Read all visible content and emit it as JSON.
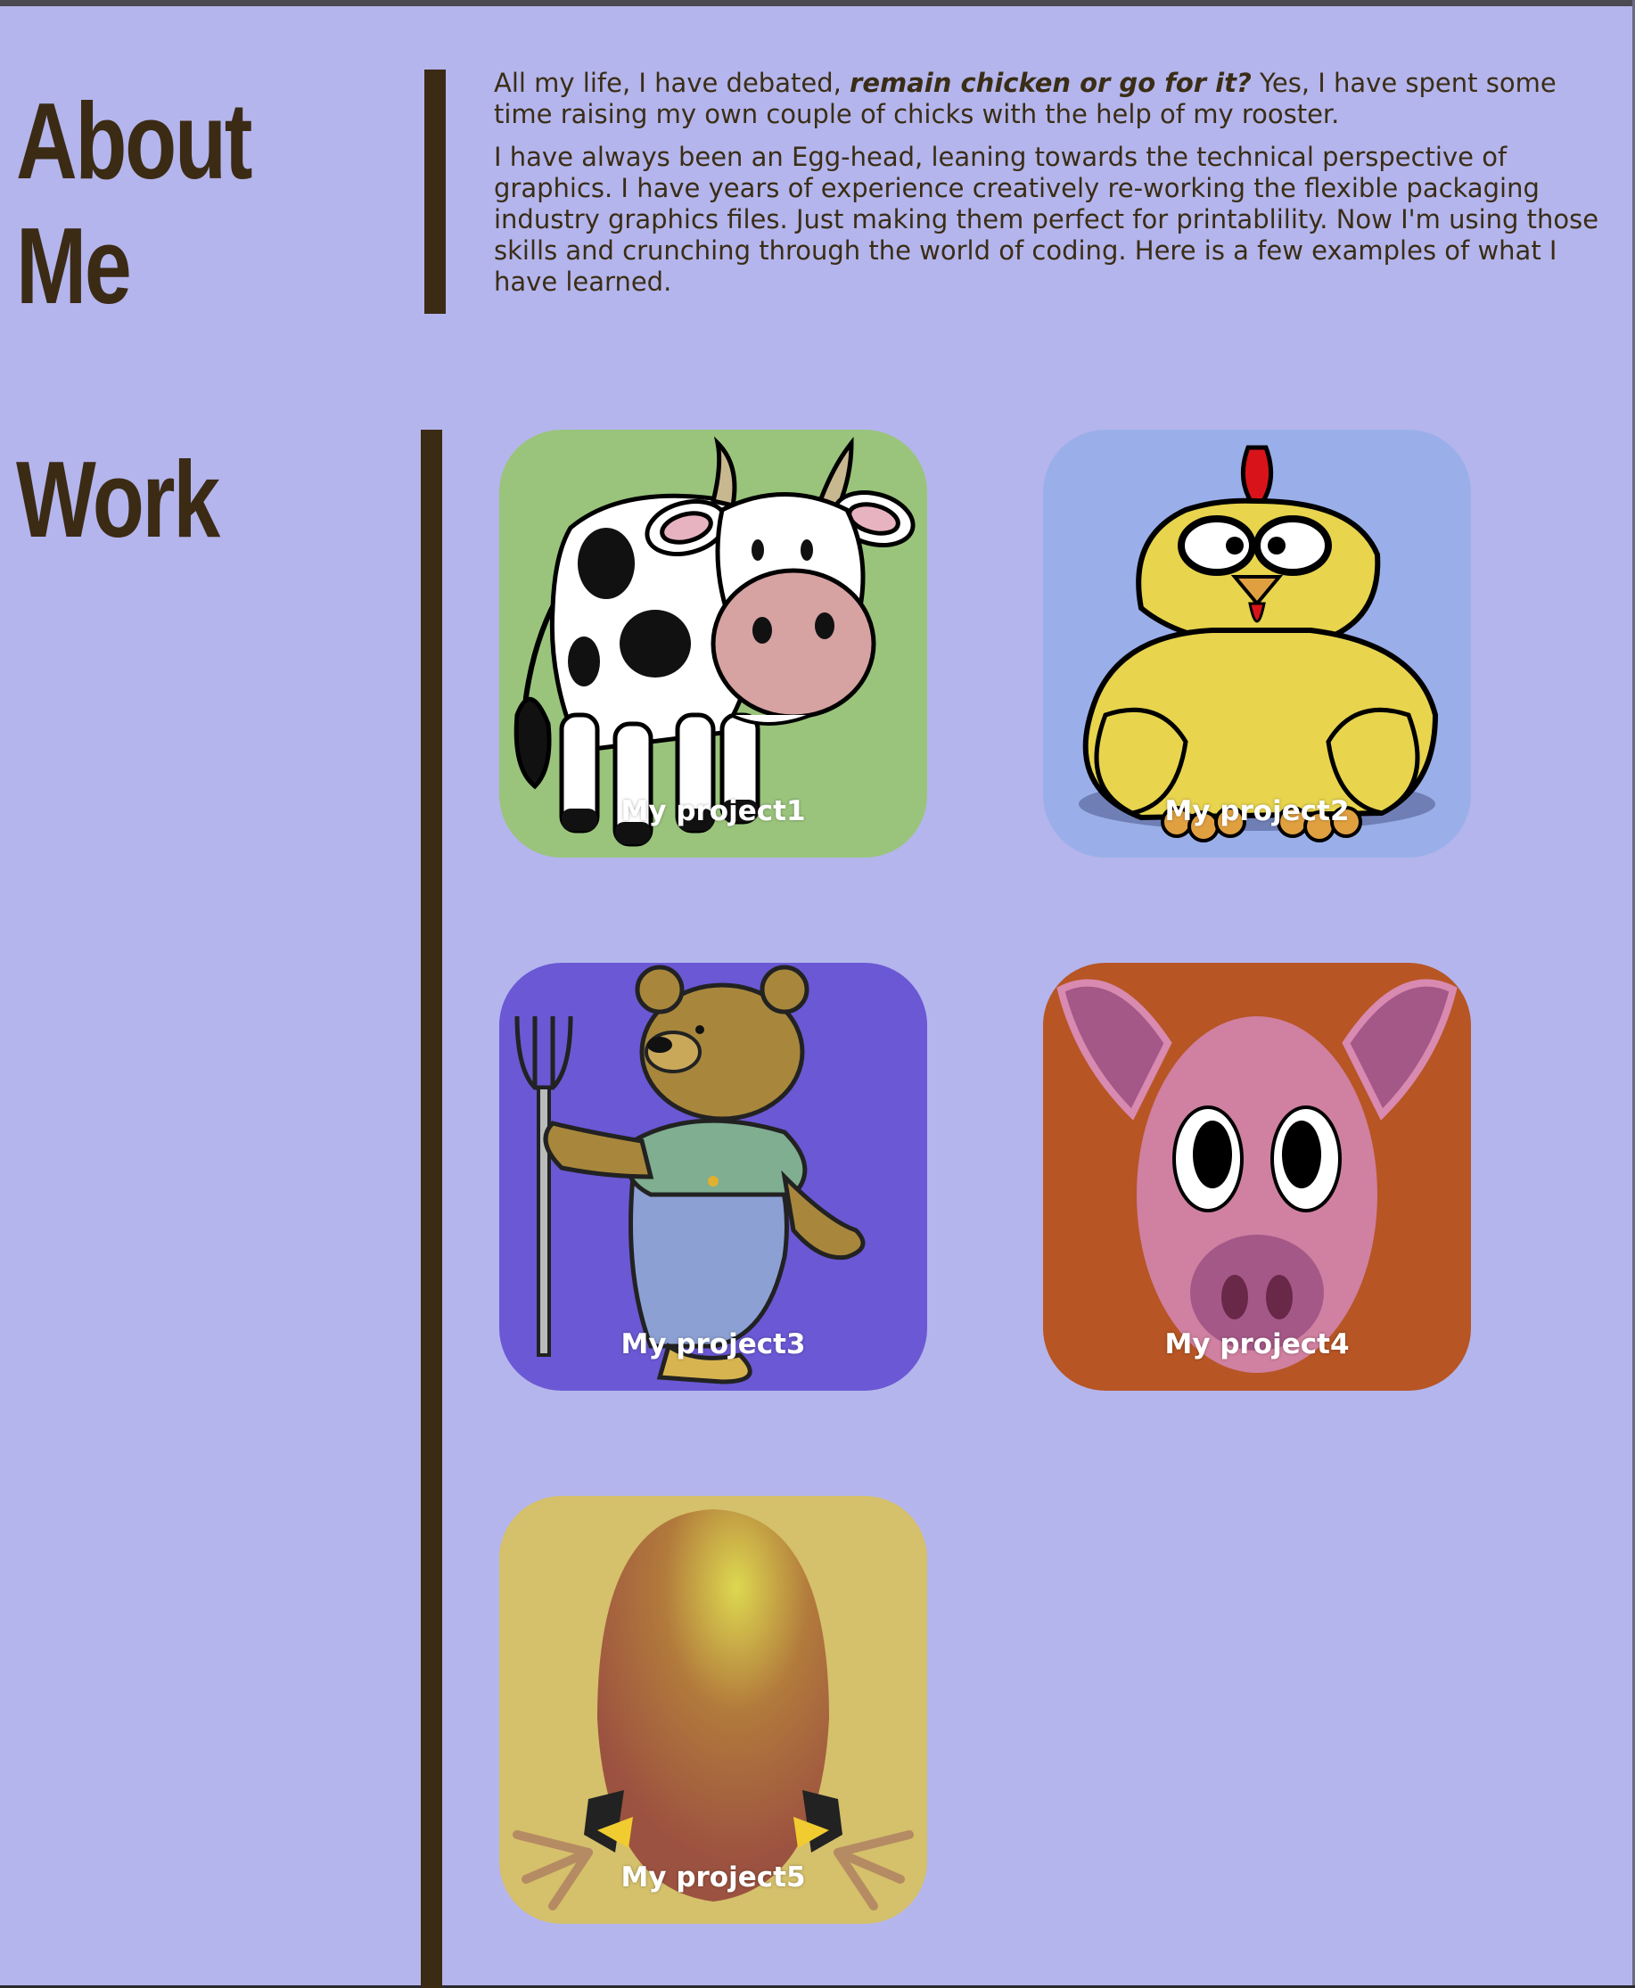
{
  "about": {
    "heading_line1": "About",
    "heading_line2": "Me",
    "p1_before": "All my life, I have debated, ",
    "p1_emphasis": "remain chicken or go for it?",
    "p1_after": " Yes, I have spent some time raising my own couple of chicks with the help of my rooster.",
    "p2": "I have always been an Egg-head, leaning towards the technical perspective of graphics. I have years of experience creatively re-working the flexible packaging industry graphics files. Just making them perfect for printablility. Now I'm using those skills and crunching through the world of coding. Here is a few examples of what I have learned."
  },
  "work": {
    "heading": "Work",
    "projects": [
      {
        "label": "My project1",
        "icon": "cow-icon",
        "bg": "#9ac47c"
      },
      {
        "label": "My project2",
        "icon": "chicken-icon",
        "bg": "#9aafe9"
      },
      {
        "label": "My project3",
        "icon": "bear-farmer-icon",
        "bg": "#6a58d4"
      },
      {
        "label": "My project4",
        "icon": "pig-icon",
        "bg": "#b75524"
      },
      {
        "label": "My project5",
        "icon": "egg-icon",
        "bg": "#d5c06b"
      }
    ]
  },
  "colors": {
    "background": "#b4b5ec",
    "text": "#3a2d16",
    "accent": "#3b2b15"
  }
}
